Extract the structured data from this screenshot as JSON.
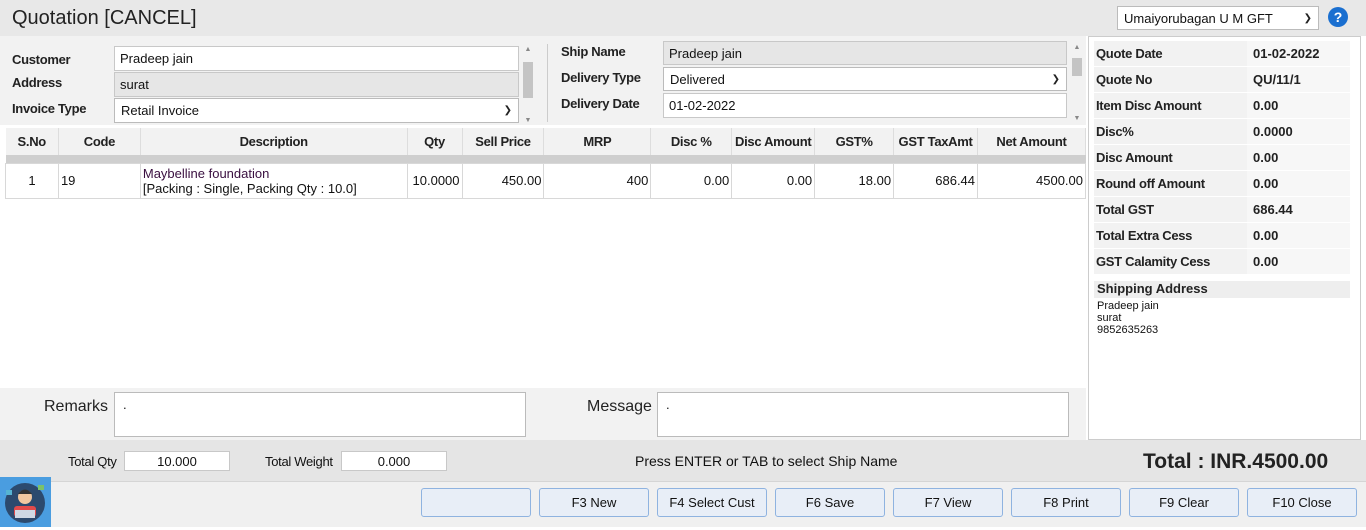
{
  "header": {
    "title": "Quotation [CANCEL]",
    "company": "Umaiyorubagan U M GFT",
    "help": "?"
  },
  "form": {
    "customer_label": "Customer",
    "customer": "Pradeep jain",
    "address_label": "Address",
    "address": "surat",
    "invoice_type_label": "Invoice Type",
    "invoice_type": "Retail Invoice",
    "ship_name_label": "Ship Name",
    "ship_name": "Pradeep jain",
    "delivery_type_label": "Delivery Type",
    "delivery_type": "Delivered",
    "delivery_date_label": "Delivery Date",
    "delivery_date": "01-02-2022"
  },
  "table": {
    "headers": [
      "S.No",
      "Code",
      "Description",
      "Qty",
      "Sell Price",
      "MRP",
      "Disc %",
      "Disc Amount",
      "GST%",
      "GST TaxAmt",
      "Net Amount"
    ],
    "rows": [
      {
        "sno": "1",
        "code": "19",
        "desc": "Maybelline foundation",
        "desc2": "[Packing : Single, Packing Qty : 10.0]",
        "qty": "10.0000",
        "sell": "450.00",
        "mrp": "400",
        "disc_pct": "0.00",
        "disc_amt": "0.00",
        "gst": "18.00",
        "gst_tax": "686.44",
        "net": "4500.00"
      }
    ]
  },
  "summary": [
    {
      "k": "Quote Date",
      "v": "01-02-2022"
    },
    {
      "k": "Quote No",
      "v": "QU/11/1"
    },
    {
      "k": "Item Disc Amount",
      "v": "0.00"
    },
    {
      "k": "Disc%",
      "v": "0.0000"
    },
    {
      "k": "Disc Amount",
      "v": "0.00"
    },
    {
      "k": "Round off Amount",
      "v": "0.00"
    },
    {
      "k": "Total GST",
      "v": "686.44"
    },
    {
      "k": "Total Extra Cess",
      "v": "0.00"
    },
    {
      "k": "GST Calamity Cess",
      "v": "0.00"
    }
  ],
  "shipping": {
    "title": "Shipping Address",
    "name": "Pradeep jain",
    "city": "surat",
    "phone": "9852635263"
  },
  "remarks": {
    "label": "Remarks",
    "value": "."
  },
  "message": {
    "label": "Message",
    "value": "."
  },
  "footer": {
    "total_qty_label": "Total Qty",
    "total_qty": "10.000",
    "total_weight_label": "Total Weight",
    "total_weight": "0.000",
    "hint": "Press ENTER or TAB to select Ship Name",
    "total": "Total : INR.4500.00"
  },
  "buttons": [
    "",
    "F3 New",
    "F4 Select Cust",
    "F6 Save",
    "F7 View",
    "F8 Print",
    "F9 Clear",
    "F10 Close"
  ]
}
